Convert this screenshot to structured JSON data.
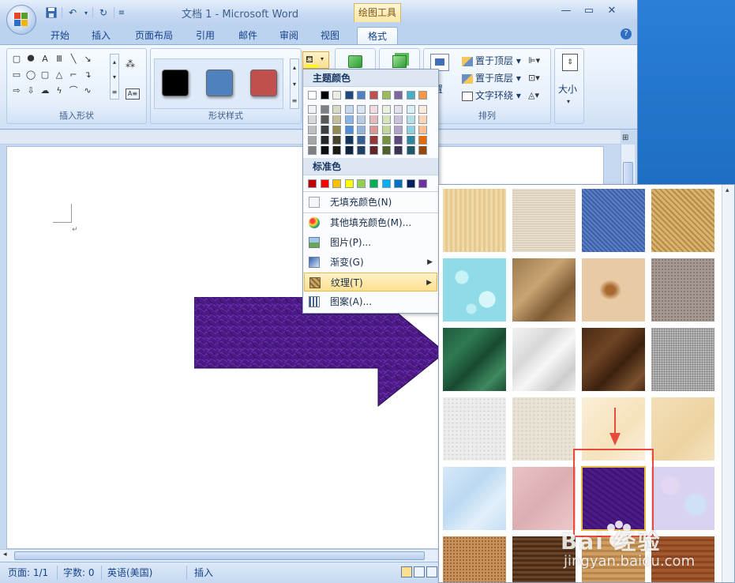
{
  "window": {
    "title": "文档 1 - Microsoft Word",
    "tool_context_header": "绘图工具",
    "controls": {
      "minimize": "—",
      "restore": "▭",
      "close": "✕"
    }
  },
  "tabs": [
    "开始",
    "插入",
    "页面布局",
    "引用",
    "邮件",
    "审阅",
    "视图",
    "格式"
  ],
  "active_tab": "格式",
  "ribbon": {
    "groups": {
      "insert_shapes": "插入形状",
      "shape_styles": "形状样式",
      "arrange": "排列",
      "size": "大小"
    },
    "shape_style_colors": [
      "#000000",
      "#4f81bd",
      "#c0504d"
    ],
    "arrange_buttons": [
      "置于顶层",
      "置于底层",
      "文字环绕"
    ],
    "arrange_partial": "置"
  },
  "fill_menu": {
    "theme_colors_header": "主题颜色",
    "theme_top_row": [
      "#ffffff",
      "#000000",
      "#eeece1",
      "#1f497d",
      "#4f81bd",
      "#c0504d",
      "#9bbb59",
      "#8064a2",
      "#4bacc6",
      "#f79646"
    ],
    "theme_shades": [
      [
        "#f2f2f2",
        "#d8d8d8",
        "#bfbfbf",
        "#a5a5a5",
        "#7f7f7f"
      ],
      [
        "#7f7f7f",
        "#595959",
        "#3f3f3f",
        "#262626",
        "#0c0c0c"
      ],
      [
        "#ddd9c3",
        "#c4bd97",
        "#938953",
        "#494429",
        "#1d1b10"
      ],
      [
        "#c6d9f0",
        "#8db3e2",
        "#548dd4",
        "#17365d",
        "#0f243e"
      ],
      [
        "#dbe5f1",
        "#b8cce4",
        "#95b3d7",
        "#366092",
        "#244061"
      ],
      [
        "#f2dcdb",
        "#e5b9b7",
        "#d99694",
        "#953734",
        "#632423"
      ],
      [
        "#ebf1dd",
        "#d7e3bc",
        "#c3d69b",
        "#76923c",
        "#4f6128"
      ],
      [
        "#e5e0ec",
        "#ccc1d9",
        "#b2a2c7",
        "#5f497a",
        "#3f3151"
      ],
      [
        "#dbeef3",
        "#b7dde8",
        "#92cddc",
        "#31859b",
        "#205867"
      ],
      [
        "#fdeada",
        "#fbd5b5",
        "#fac08f",
        "#e36c09",
        "#974806"
      ]
    ],
    "standard_colors_header": "标准色",
    "standard_colors": [
      "#c00000",
      "#ff0000",
      "#ffc000",
      "#ffff00",
      "#92d050",
      "#00b050",
      "#00b0f0",
      "#0070c0",
      "#002060",
      "#7030a0"
    ],
    "items": [
      {
        "label": "无填充颜色(N)",
        "icon": "no-fill-icon",
        "submenu": false
      },
      {
        "label": "其他填充颜色(M)...",
        "icon": "palette-icon",
        "submenu": false
      },
      {
        "label": "图片(P)...",
        "icon": "picture-icon",
        "submenu": false
      },
      {
        "label": "渐变(G)",
        "icon": "gradient-icon",
        "submenu": true
      },
      {
        "label": "纹理(T)",
        "icon": "texture-icon",
        "submenu": true,
        "highlighted": true
      },
      {
        "label": "图案(A)...",
        "icon": "pattern-icon",
        "submenu": false
      }
    ]
  },
  "texture_panel": {
    "selected_index": 18,
    "textures": [
      "papyrus",
      "canvas",
      "denim",
      "woven-mat",
      "water-droplets",
      "paper-bag",
      "fish-fossil",
      "sand",
      "green-marble",
      "white-marble",
      "brown-marble",
      "granite",
      "newsprint",
      "recycled-paper",
      "parchment",
      "stationery",
      "blue-tissue-paper",
      "pink-tissue-paper",
      "purple-mesh",
      "bouquet",
      "cork",
      "walnut",
      "oak",
      "medium-wood"
    ]
  },
  "status_bar": {
    "page": "页面: 1/1",
    "words": "字数: 0",
    "language": "英语(美国)",
    "mode": "插入"
  },
  "watermark": {
    "brand": "Bai 经验",
    "url": "jingyan.baidu.com"
  },
  "shape_fill_color": "#4b1a86"
}
